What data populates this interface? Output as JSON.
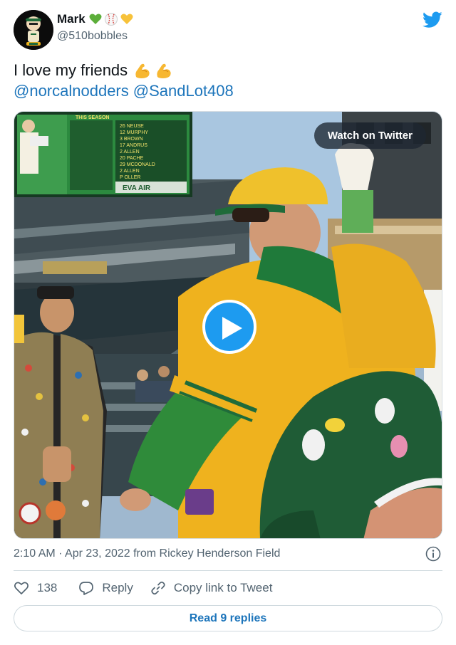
{
  "author": {
    "display_name": "Mark",
    "handle": "@510bobbles",
    "badges": [
      "green-heart",
      "baseball",
      "yellow-heart"
    ]
  },
  "tweet": {
    "text": "I love my friends",
    "emoji": "flexed-biceps",
    "mentions": [
      "@norcalnodders",
      "@SandLot408"
    ]
  },
  "media": {
    "type": "video",
    "watch_label": "Watch on Twitter",
    "scoreboard": {
      "header": "THIS SEASON",
      "lineup": [
        "26 NEUSE",
        "12 MURPHY",
        "3 BROWN",
        "17 ANDRUS",
        "2 ALLEN",
        "20 PACHE",
        "29 MCDONALD",
        "2 ALLEN",
        "P OLLER"
      ],
      "sponsor": "EVA AIR"
    }
  },
  "meta": {
    "timestamp": "2:10 AM · Apr 23, 2022 from Rickey Henderson Field"
  },
  "actions": {
    "likes": "138",
    "reply_label": "Reply",
    "copy_label": "Copy link to Tweet"
  },
  "footer": {
    "read_replies_label": "Read 9 replies"
  },
  "colors": {
    "link": "#1d75bb",
    "play": "#1d9bf0",
    "twitter_blue": "#1d9bf0",
    "athletics_green": "#1f6b3a",
    "athletics_gold": "#efb21e"
  }
}
